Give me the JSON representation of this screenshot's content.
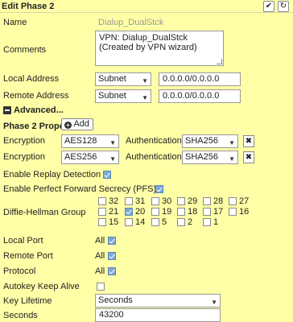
{
  "header": {
    "title": "Edit Phase 2",
    "ok_icon": "check-circle-icon",
    "revert_icon": "revert-icon"
  },
  "fields": {
    "name_label": "Name",
    "name_value": "Dialup_DualStck",
    "comments_label": "Comments",
    "comments_value": "VPN: Dialup_DualStck (Created by VPN wizard)",
    "local_label": "Local Address",
    "local_type": "Subnet",
    "local_value": "0.0.0.0/0.0.0.0",
    "remote_label": "Remote Address",
    "remote_type": "Subnet",
    "remote_value": "0.0.0.0/0.0.0.0",
    "advanced_label": "Advanced..."
  },
  "proposal": {
    "label": "Phase 2 Proposal",
    "add_label": "Add",
    "rows": [
      {
        "enc_label": "Encryption",
        "encryption": "AES128",
        "auth_label": "Authentication",
        "authentication": "SHA256"
      },
      {
        "enc_label": "Encryption",
        "encryption": "AES256",
        "auth_label": "Authentication",
        "authentication": "SHA256"
      }
    ]
  },
  "options": {
    "replay_label": "Enable Replay Detection",
    "replay_checked": true,
    "pfs_label": "Enable Perfect Forward Secrecy (PFS)",
    "pfs_checked": true,
    "dh_label": "Diffie-Hellman Group",
    "dh_groups": [
      {
        "num": "32",
        "checked": false
      },
      {
        "num": "31",
        "checked": false
      },
      {
        "num": "30",
        "checked": false
      },
      {
        "num": "29",
        "checked": false
      },
      {
        "num": "28",
        "checked": false
      },
      {
        "num": "27",
        "checked": false
      },
      {
        "num": "21",
        "checked": false
      },
      {
        "num": "20",
        "checked": true
      },
      {
        "num": "19",
        "checked": false
      },
      {
        "num": "18",
        "checked": false
      },
      {
        "num": "17",
        "checked": false
      },
      {
        "num": "16",
        "checked": false
      },
      {
        "num": "15",
        "checked": false
      },
      {
        "num": "14",
        "checked": false
      },
      {
        "num": "5",
        "checked": false
      },
      {
        "num": "2",
        "checked": false
      },
      {
        "num": "1",
        "checked": false
      }
    ],
    "local_port_label": "Local Port",
    "local_port_all": "All",
    "remote_port_label": "Remote Port",
    "remote_port_all": "All",
    "protocol_label": "Protocol",
    "protocol_all": "All",
    "autokey_label": "Autokey Keep Alive",
    "key_lifetime_label": "Key Lifetime",
    "key_lifetime_value": "Seconds",
    "seconds_label": "Seconds",
    "seconds_value": "43200"
  }
}
